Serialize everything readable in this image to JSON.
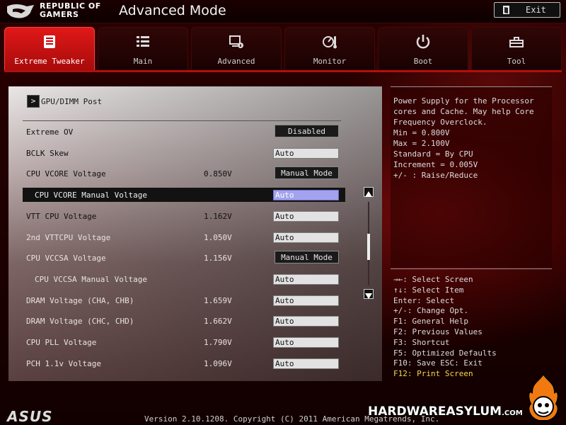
{
  "header": {
    "brand_line1": "REPUBLIC OF",
    "brand_line2": "GAMERS",
    "mode_title": "Advanced Mode",
    "exit_label": "Exit"
  },
  "tabs": [
    {
      "label": "Extreme Tweaker",
      "icon": "extreme-tweaker-icon",
      "active": true
    },
    {
      "label": "Main",
      "icon": "list-icon",
      "active": false
    },
    {
      "label": "Advanced",
      "icon": "advanced-icon",
      "active": false
    },
    {
      "label": "Monitor",
      "icon": "monitor-icon",
      "active": false
    },
    {
      "label": "Boot",
      "icon": "power-icon",
      "active": false
    },
    {
      "label": "Tool",
      "icon": "tool-icon",
      "active": false
    }
  ],
  "main": {
    "breadcrumb": "GPU/DIMM Post",
    "rows": [
      {
        "label": "Extreme OV",
        "value": "",
        "control": "dropdown",
        "setting": "Disabled"
      },
      {
        "label": "BCLK Skew",
        "value": "",
        "control": "input",
        "setting": "Auto"
      },
      {
        "label": "CPU VCORE Voltage",
        "value": "0.850V",
        "control": "dropdown",
        "setting": "Manual Mode"
      },
      {
        "label": "CPU VCORE Manual Voltage",
        "value": "",
        "control": "input",
        "setting": "Auto",
        "selected": true,
        "indent": true
      },
      {
        "label": "VTT CPU Voltage",
        "value": "1.162V",
        "control": "input",
        "setting": "Auto"
      },
      {
        "label": "2nd VTTCPU Voltage",
        "value": "1.050V",
        "control": "input",
        "setting": "Auto"
      },
      {
        "label": "CPU VCCSA Voltage",
        "value": "1.156V",
        "control": "dropdown",
        "setting": "Manual Mode"
      },
      {
        "label": "CPU VCCSA Manual Voltage",
        "value": "",
        "control": "input",
        "setting": "Auto",
        "indent": true
      },
      {
        "label": "DRAM Voltage (CHA, CHB)",
        "value": "1.659V",
        "control": "input",
        "setting": "Auto"
      },
      {
        "label": "DRAM Voltage (CHC, CHD)",
        "value": "1.662V",
        "control": "input",
        "setting": "Auto"
      },
      {
        "label": "CPU PLL Voltage",
        "value": "1.790V",
        "control": "input",
        "setting": "Auto"
      },
      {
        "label": "PCH 1.1v Voltage",
        "value": "1.096V",
        "control": "input",
        "setting": "Auto"
      }
    ],
    "scroll_position": 0.55
  },
  "help": {
    "text": "Power Supply for the Processor cores and Cache. May help Core Frequency Overclock.\nMin = 0.800V\nMax = 2.100V\nStandard = By CPU\nIncrement = 0.005V\n+/- : Raise/Reduce"
  },
  "keys": [
    "→←: Select Screen",
    "↑↓: Select Item",
    "Enter: Select",
    "+/-: Change Opt.",
    "F1: General Help",
    "F2: Previous Values",
    "F3: Shortcut",
    "F5: Optimized Defaults",
    "F10: Save  ESC: Exit",
    "F12: Print Screen"
  ],
  "footer": {
    "asus_logo": "ASUS",
    "version": "Version 2.10.1208. Copyright (C) 2011 American Megatrends, Inc.",
    "watermark": "HARDWAREASYLUM",
    "watermark_suffix": ".COM"
  },
  "colors": {
    "active_tab": "#e01818",
    "selected_input": "#a2a2ee",
    "highlight_key": "#f2d84a"
  }
}
